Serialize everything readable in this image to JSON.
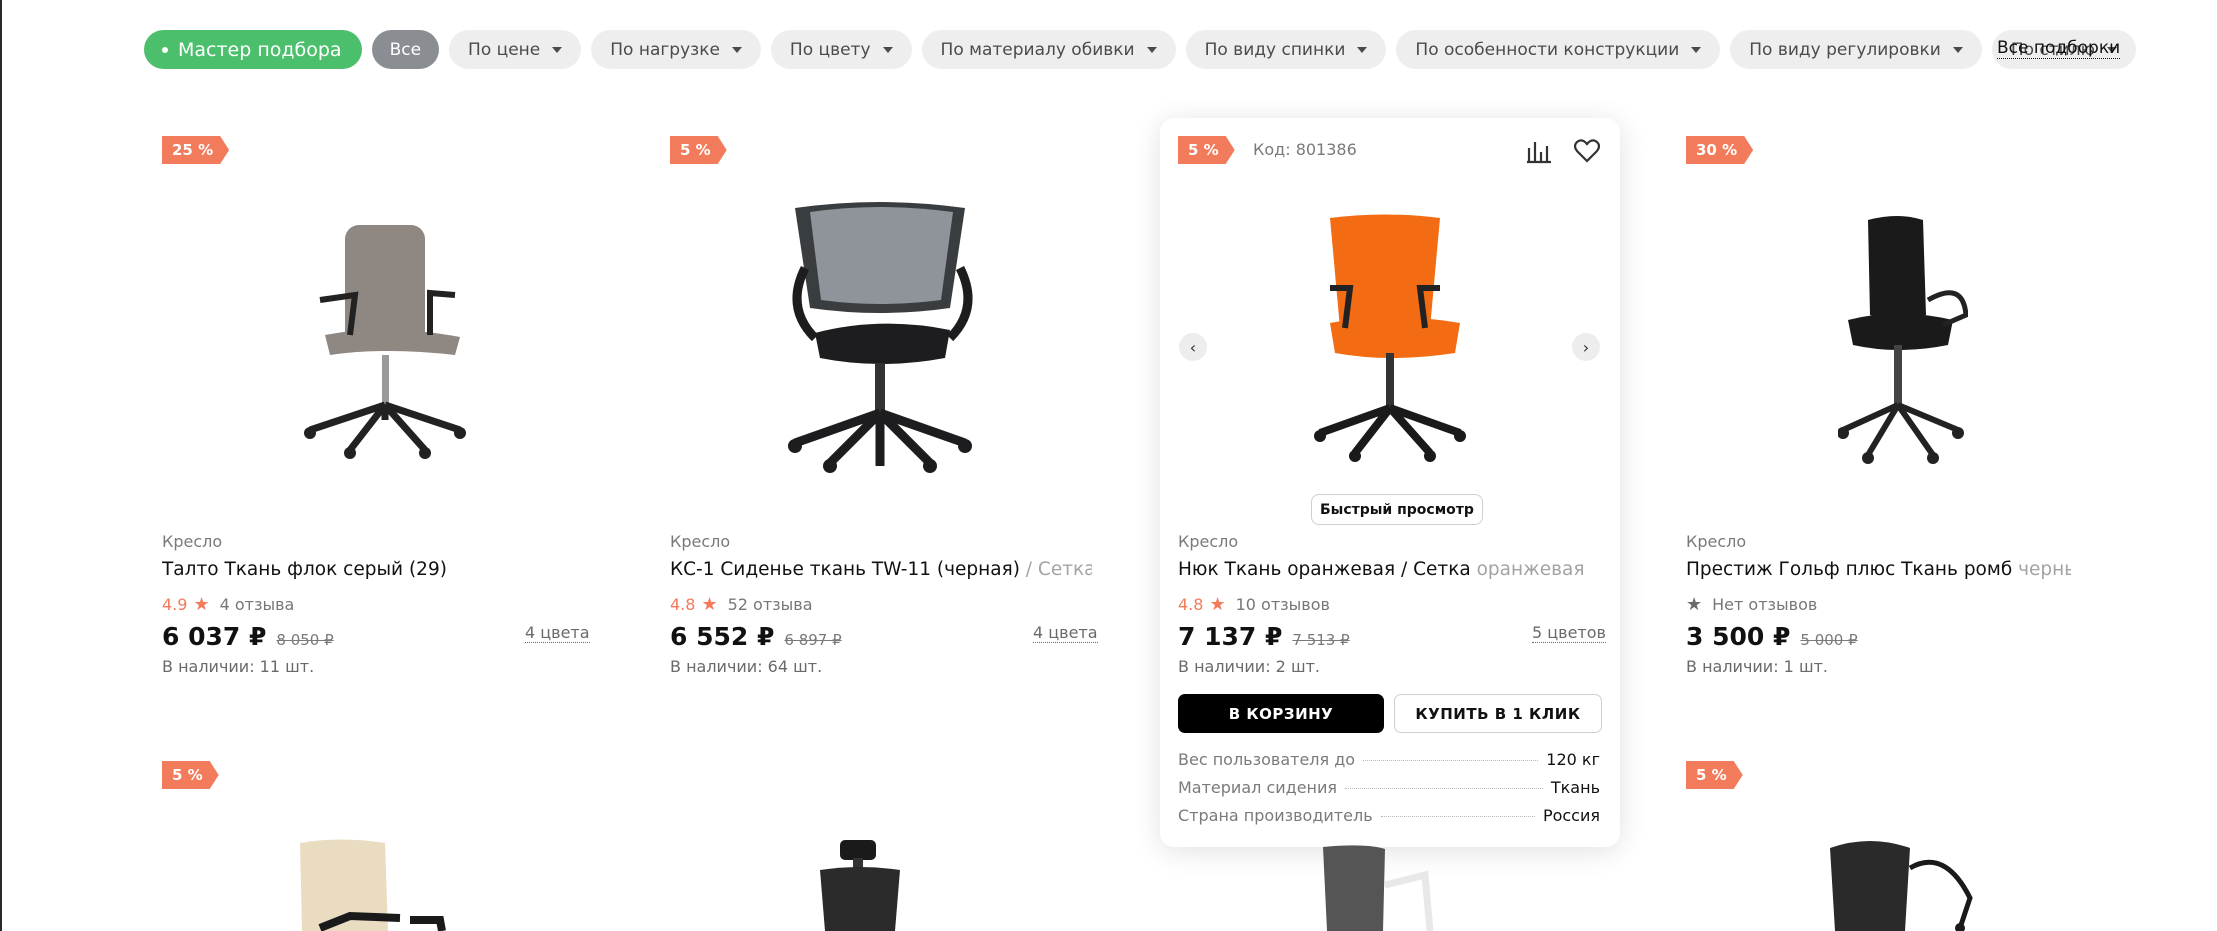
{
  "filters": {
    "master": "Мастер подбора",
    "all": "Все",
    "items": [
      "По цене",
      "По нагрузке",
      "По цвету",
      "По материалу обивки",
      "По виду спинки",
      "По особенности конструкции",
      "По виду регулировки",
      "По стилю"
    ],
    "all_link": "Все подборки"
  },
  "products": [
    {
      "badge": "25 %",
      "category": "Кресло",
      "title": "Талто Ткань флок серый (29)",
      "title_fade": "",
      "rating": "4.9",
      "reviews": "4 отзыва",
      "price": "6 037 ₽",
      "old_price": "8 050 ₽",
      "colors": "4 цвета",
      "stock": "В наличии: 11 шт.",
      "seat_color": "#8f8782"
    },
    {
      "badge": "5 %",
      "category": "Кресло",
      "title": "КС-1 Сиденье ткань TW-11 (черная)",
      "title_fade": " / Сетка TW",
      "rating": "4.8",
      "reviews": "52 отзыва",
      "price": "6 552 ₽",
      "old_price": "6 897 ₽",
      "colors": "4 цвета",
      "stock": "В наличии: 64 шт.",
      "seat_color": "#1d1d1f"
    },
    {
      "badge": "5 %",
      "code": "Код: 801386",
      "category": "Кресло",
      "title": "Нюк Ткань оранжевая / Сетка ",
      "title_fade": "оранжевая",
      "rating": "4.8",
      "reviews": "10 отзывов",
      "price": "7 137 ₽",
      "old_price": "7 513 ₽",
      "colors": "5 цветов",
      "stock": "В наличии: 2 шт.",
      "quick_view": "Быстрый просмотр",
      "cart": "В КОРЗИНУ",
      "one_click": "КУПИТЬ В 1 КЛИК",
      "specs": [
        {
          "k": "Вес пользователя до",
          "v": "120 кг"
        },
        {
          "k": "Материал сидения",
          "v": "Ткань"
        },
        {
          "k": "Страна производитель",
          "v": "Россия"
        }
      ],
      "seat_color": "#f36b12"
    },
    {
      "badge": "30 %",
      "category": "Кресло",
      "title": "Престиж Гольф плюс Ткань ромб ",
      "title_fade": "черный",
      "rating": "",
      "reviews": "Нет отзывов",
      "price": "3 500 ₽",
      "old_price": "5 000 ₽",
      "stock": "В наличии: 1 шт.",
      "seat_color": "#1a1a1a"
    }
  ],
  "row2_badges": [
    "5 %",
    "5 %"
  ],
  "colors": {
    "accent": "#f27b5b",
    "master": "#4cbf6c"
  }
}
